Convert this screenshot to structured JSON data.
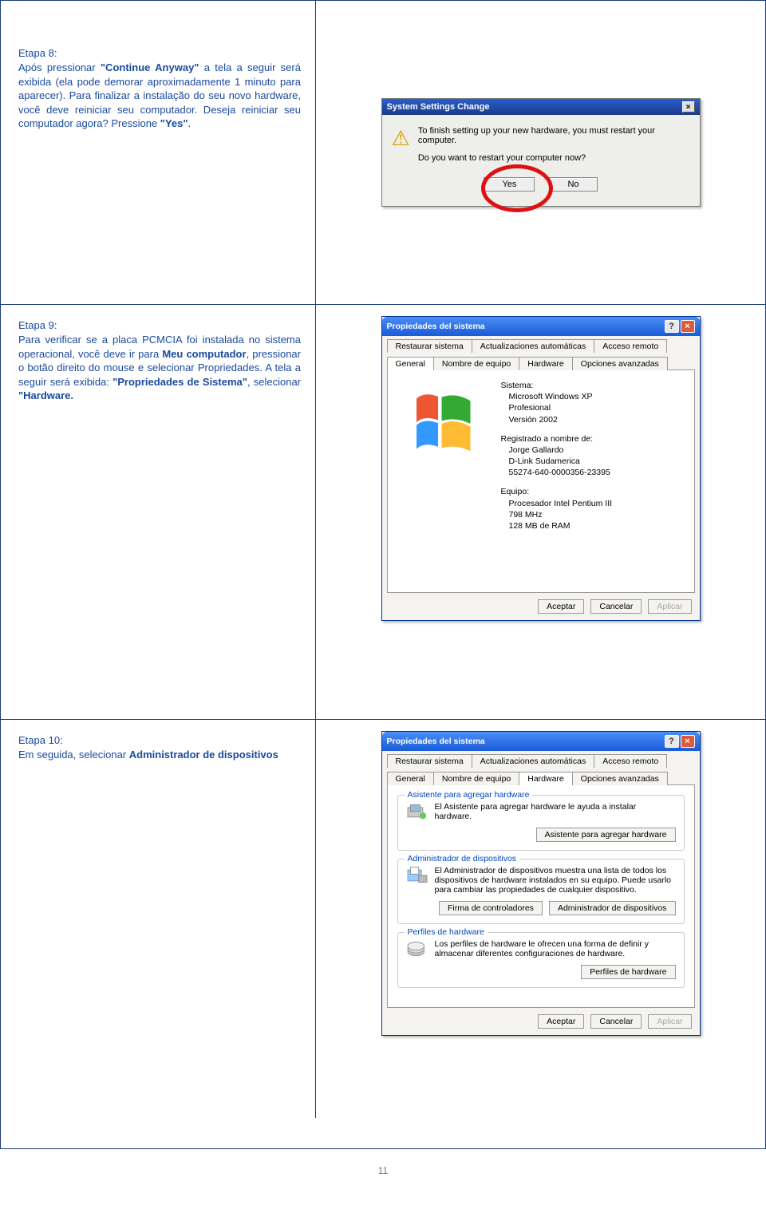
{
  "page_number": "11",
  "step8": {
    "title": "Etapa 8:",
    "text_before_q1": "Após pressionar ",
    "q1": "\"Continue Anyway\"",
    "text_after_q1": " a tela a seguir será exibida (ela pode demorar aproximadamente 1 minuto para aparecer). Para finalizar a instalação do seu novo hardware, você deve reiniciar seu computador. Deseja reiniciar seu computador agora? Pressione ",
    "q2": "\"Yes\"",
    "text_end": "."
  },
  "step9": {
    "title": "Etapa 9:",
    "t1": "Para verificar se a placa PCMCIA foi instalada no sistema operacional, você deve ir para ",
    "b1": "Meu computador",
    "t2": ", pressionar o botão direito do mouse e selecionar Propriedades. A tela a seguir será exibida: ",
    "b2": "\"Propriedades de Sistema\"",
    "t3": ", selecionar ",
    "b3": "\"Hardware."
  },
  "step10": {
    "title": "Etapa 10:",
    "t1": "Em seguida, selecionar ",
    "b1": "Administrador de dispositivos"
  },
  "dlg1": {
    "title": "System Settings Change",
    "msg1": "To finish setting up your new hardware, you must restart your computer.",
    "msg2": "Do you want to restart your computer now?",
    "yes": "Yes",
    "no": "No"
  },
  "props": {
    "title": "Propiedades del sistema",
    "tabs_top": [
      "Restaurar sistema",
      "Actualizaciones automáticas",
      "Acceso remoto"
    ],
    "tabs_bottom": [
      "General",
      "Nombre de equipo",
      "Hardware",
      "Opciones avanzadas"
    ],
    "buttons": {
      "ok": "Aceptar",
      "cancel": "Cancelar",
      "apply": "Aplicar"
    }
  },
  "general_tab": {
    "sistema_label": "Sistema:",
    "sistema_lines": [
      "Microsoft Windows XP",
      "Profesional",
      "Versión 2002"
    ],
    "registrado_label": "Registrado a nombre de:",
    "registrado_lines": [
      "Jorge Gallardo",
      "D-Link Sudamerica",
      "55274-640-0000356-23395"
    ],
    "equipo_label": "Equipo:",
    "equipo_lines": [
      "Procesador Intel Pentium III",
      "798 MHz",
      "128 MB de RAM"
    ]
  },
  "hardware_tab": {
    "assist": {
      "legend": "Asistente para agregar hardware",
      "desc": "El Asistente para agregar hardware le ayuda a instalar hardware.",
      "btn": "Asistente para agregar hardware"
    },
    "admin": {
      "legend": "Administrador de dispositivos",
      "desc": "El Administrador de dispositivos muestra una lista de todos los dispositivos de hardware instalados en su equipo. Puede usarlo para cambiar las propiedades de cualquier dispositivo.",
      "btn1": "Firma de controladores",
      "btn2": "Administrador de dispositivos"
    },
    "profiles": {
      "legend": "Perfiles de hardware",
      "desc": "Los perfiles de hardware le ofrecen una forma de definir y almacenar diferentes configuraciones de hardware.",
      "btn": "Perfiles de hardware"
    }
  }
}
